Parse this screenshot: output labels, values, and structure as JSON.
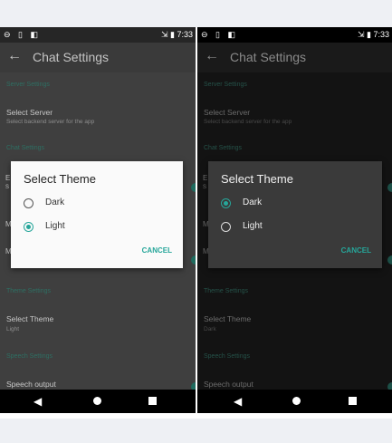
{
  "screens": [
    {
      "theme": "light",
      "status": {
        "left_icons": "⊖ ▯ ◧",
        "right": "⇲ ▮ 7:33"
      },
      "appbar": {
        "title": "Chat Settings"
      },
      "settings": {
        "server_header": "Server Settings",
        "select_server_title": "Select Server",
        "select_server_sub": "Select backend server for the app",
        "chat_header": "Chat Settings",
        "theme_header": "Theme Settings",
        "select_theme_title": "Select Theme",
        "select_theme_sub": "Light",
        "speech_header": "Speech Settings",
        "speech_output": "Speech output"
      },
      "fragments": {
        "e": "E",
        "s": "S",
        "m": "M",
        "m2": "M"
      },
      "dialog": {
        "title": "Select Theme",
        "options": [
          {
            "label": "Dark",
            "selected": false
          },
          {
            "label": "Light",
            "selected": true
          }
        ],
        "cancel": "CANCEL"
      },
      "nav": {
        "back": "◀"
      }
    },
    {
      "theme": "dark",
      "status": {
        "left_icons": "⊖ ▯ ◧",
        "right": "⇲ ▮ 7:33"
      },
      "appbar": {
        "title": "Chat Settings"
      },
      "settings": {
        "server_header": "Server Settings",
        "select_server_title": "Select Server",
        "select_server_sub": "Select backend server for the app",
        "chat_header": "Chat Settings",
        "theme_header": "Theme Settings",
        "select_theme_title": "Select Theme",
        "select_theme_sub": "Dark",
        "speech_header": "Speech Settings",
        "speech_output": "Speech output"
      },
      "fragments": {
        "e": "E",
        "s": "S",
        "m": "M",
        "m2": "M"
      },
      "dialog": {
        "title": "Select Theme",
        "options": [
          {
            "label": "Dark",
            "selected": true
          },
          {
            "label": "Light",
            "selected": false
          }
        ],
        "cancel": "CANCEL"
      },
      "nav": {
        "back": "◀"
      }
    }
  ],
  "colors": {
    "accent": "#26a69a"
  }
}
